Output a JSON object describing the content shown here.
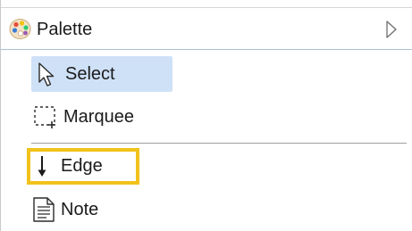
{
  "palette": {
    "title": "Palette",
    "icon": "palette-icon",
    "expand_icon": "triangle-right-icon"
  },
  "tools": {
    "select": {
      "label": "Select",
      "icon": "arrow-cursor-icon",
      "selected": true
    },
    "marquee": {
      "label": "Marquee",
      "icon": "marquee-icon"
    },
    "edge": {
      "label": "Edge",
      "icon": "down-arrow-icon",
      "highlighted": true
    },
    "note": {
      "label": "Note",
      "icon": "note-icon"
    }
  },
  "colors": {
    "selected_background": "#cfe1f7",
    "highlight_border": "#f1c21b",
    "separator": "#9e9e9e"
  }
}
